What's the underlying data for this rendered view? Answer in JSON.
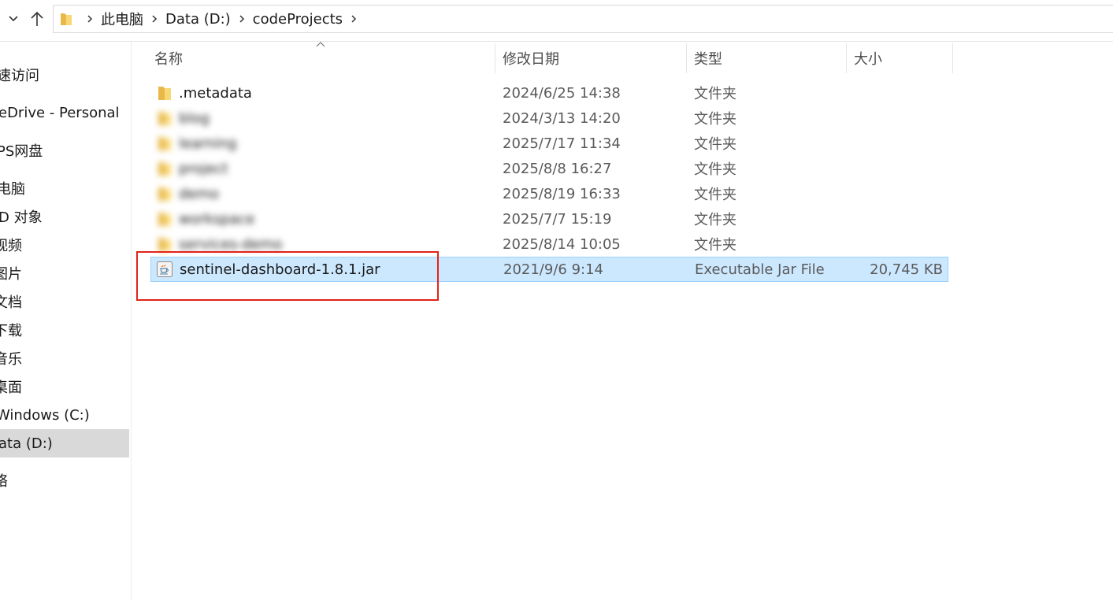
{
  "toolbar": {
    "back_icon": "chevron-down-icon",
    "up_icon": "arrow-up-icon"
  },
  "address": {
    "folder_icon": "folder-icon",
    "breadcrumbs": [
      "此电脑",
      "Data (D:)",
      "codeProjects"
    ]
  },
  "sidebar": {
    "items": [
      {
        "label": "速访问"
      },
      {
        "label": "eDrive - Personal"
      },
      {
        "label": "PS网盘"
      },
      {
        "label": "电脑"
      },
      {
        "label": "D 对象"
      },
      {
        "label": "视频"
      },
      {
        "label": "图片"
      },
      {
        "label": "文档"
      },
      {
        "label": "下载"
      },
      {
        "label": "音乐"
      },
      {
        "label": "桌面"
      },
      {
        "label": "Windows (C:)"
      },
      {
        "label": "ata (D:)",
        "selected": true
      },
      {
        "label": "络"
      }
    ]
  },
  "columns": {
    "name": "名称",
    "date": "修改日期",
    "type": "类型",
    "size": "大小"
  },
  "files": [
    {
      "name": ".metadata",
      "date": "2024/6/25 14:38",
      "type": "文件夹",
      "size": "",
      "kind": "folder",
      "blurred": false
    },
    {
      "name": "blog",
      "date": "2024/3/13 14:20",
      "type": "文件夹",
      "size": "",
      "kind": "folder",
      "blurred": true
    },
    {
      "name": "learning",
      "date": "2025/7/17 11:34",
      "type": "文件夹",
      "size": "",
      "kind": "folder",
      "blurred": true
    },
    {
      "name": "project",
      "date": "2025/8/8 16:27",
      "type": "文件夹",
      "size": "",
      "kind": "folder",
      "blurred": true
    },
    {
      "name": "demo",
      "date": "2025/8/19 16:33",
      "type": "文件夹",
      "size": "",
      "kind": "folder",
      "blurred": true
    },
    {
      "name": "workspace",
      "date": "2025/7/7 15:19",
      "type": "文件夹",
      "size": "",
      "kind": "folder",
      "blurred": true
    },
    {
      "name": "services-demo",
      "date": "2025/8/14 10:05",
      "type": "文件夹",
      "size": "",
      "kind": "folder",
      "blurred": true
    },
    {
      "name": "sentinel-dashboard-1.8.1.jar",
      "date": "2021/9/6 9:14",
      "type": "Executable Jar File",
      "size": "20,745 KB",
      "kind": "jar",
      "blurred": false,
      "selected": true
    }
  ],
  "colors": {
    "selection_bg": "#cce8ff",
    "selection_border": "#99d1ff",
    "highlight_box": "#e2231a",
    "folder_yellow": "#f8d775"
  }
}
